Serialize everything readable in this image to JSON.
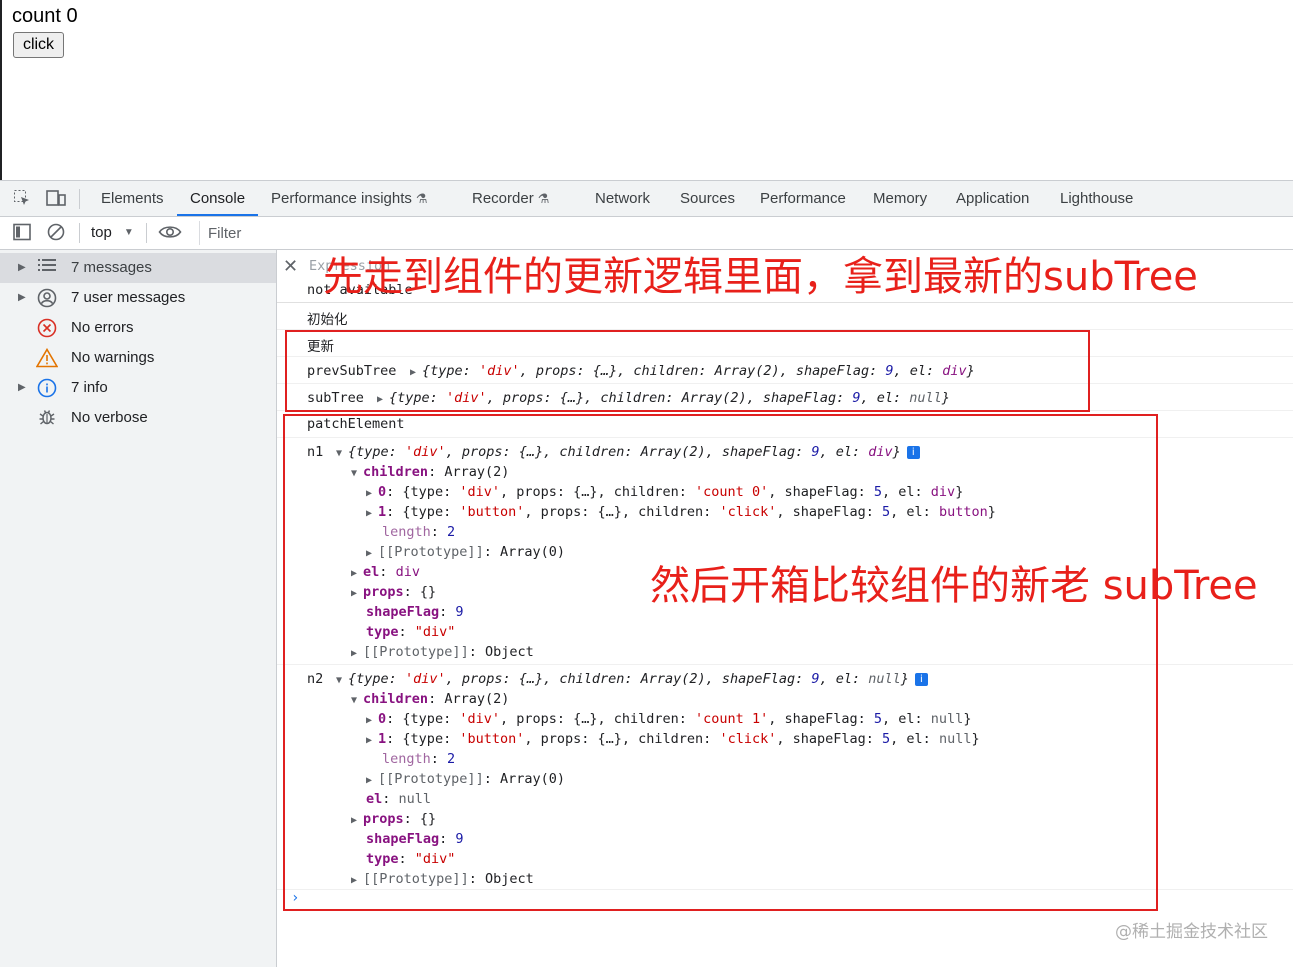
{
  "page": {
    "count_text": "count 0",
    "button_label": "click"
  },
  "devtools": {
    "tabs": [
      "Elements",
      "Console",
      "Performance insights",
      "Recorder",
      "Network",
      "Sources",
      "Performance",
      "Memory",
      "Application",
      "Lighthouse"
    ],
    "active_tab": "Console",
    "context": "top",
    "filter_placeholder": "Filter"
  },
  "sidebar": {
    "items": [
      {
        "label": "7 messages",
        "icon": "list-icon",
        "expandable": true,
        "selected": true
      },
      {
        "label": "7 user messages",
        "icon": "user-icon",
        "expandable": true
      },
      {
        "label": "No errors",
        "icon": "error-icon"
      },
      {
        "label": "No warnings",
        "icon": "warning-icon"
      },
      {
        "label": "7 info",
        "icon": "info-icon",
        "expandable": true
      },
      {
        "label": "No verbose",
        "icon": "bug-icon"
      }
    ]
  },
  "console": {
    "expression_label": "Expression",
    "expression_value": "not available",
    "log_init": "初始化",
    "log_update": "更新",
    "prev_label": "prevSubTree",
    "sub_label": "subTree",
    "patch_label": "patchElement",
    "n1_label": "n1",
    "n2_label": "n2"
  },
  "annotations": {
    "top": "先走到组件的更新逻辑里面，拿到最新的subTree",
    "middle": "然后开箱比较组件的新老 subTree"
  },
  "watermark": "@稀土掘金技术社区",
  "colors": {
    "annotation_red": "#e02020",
    "accent_blue": "#1a73e8"
  }
}
